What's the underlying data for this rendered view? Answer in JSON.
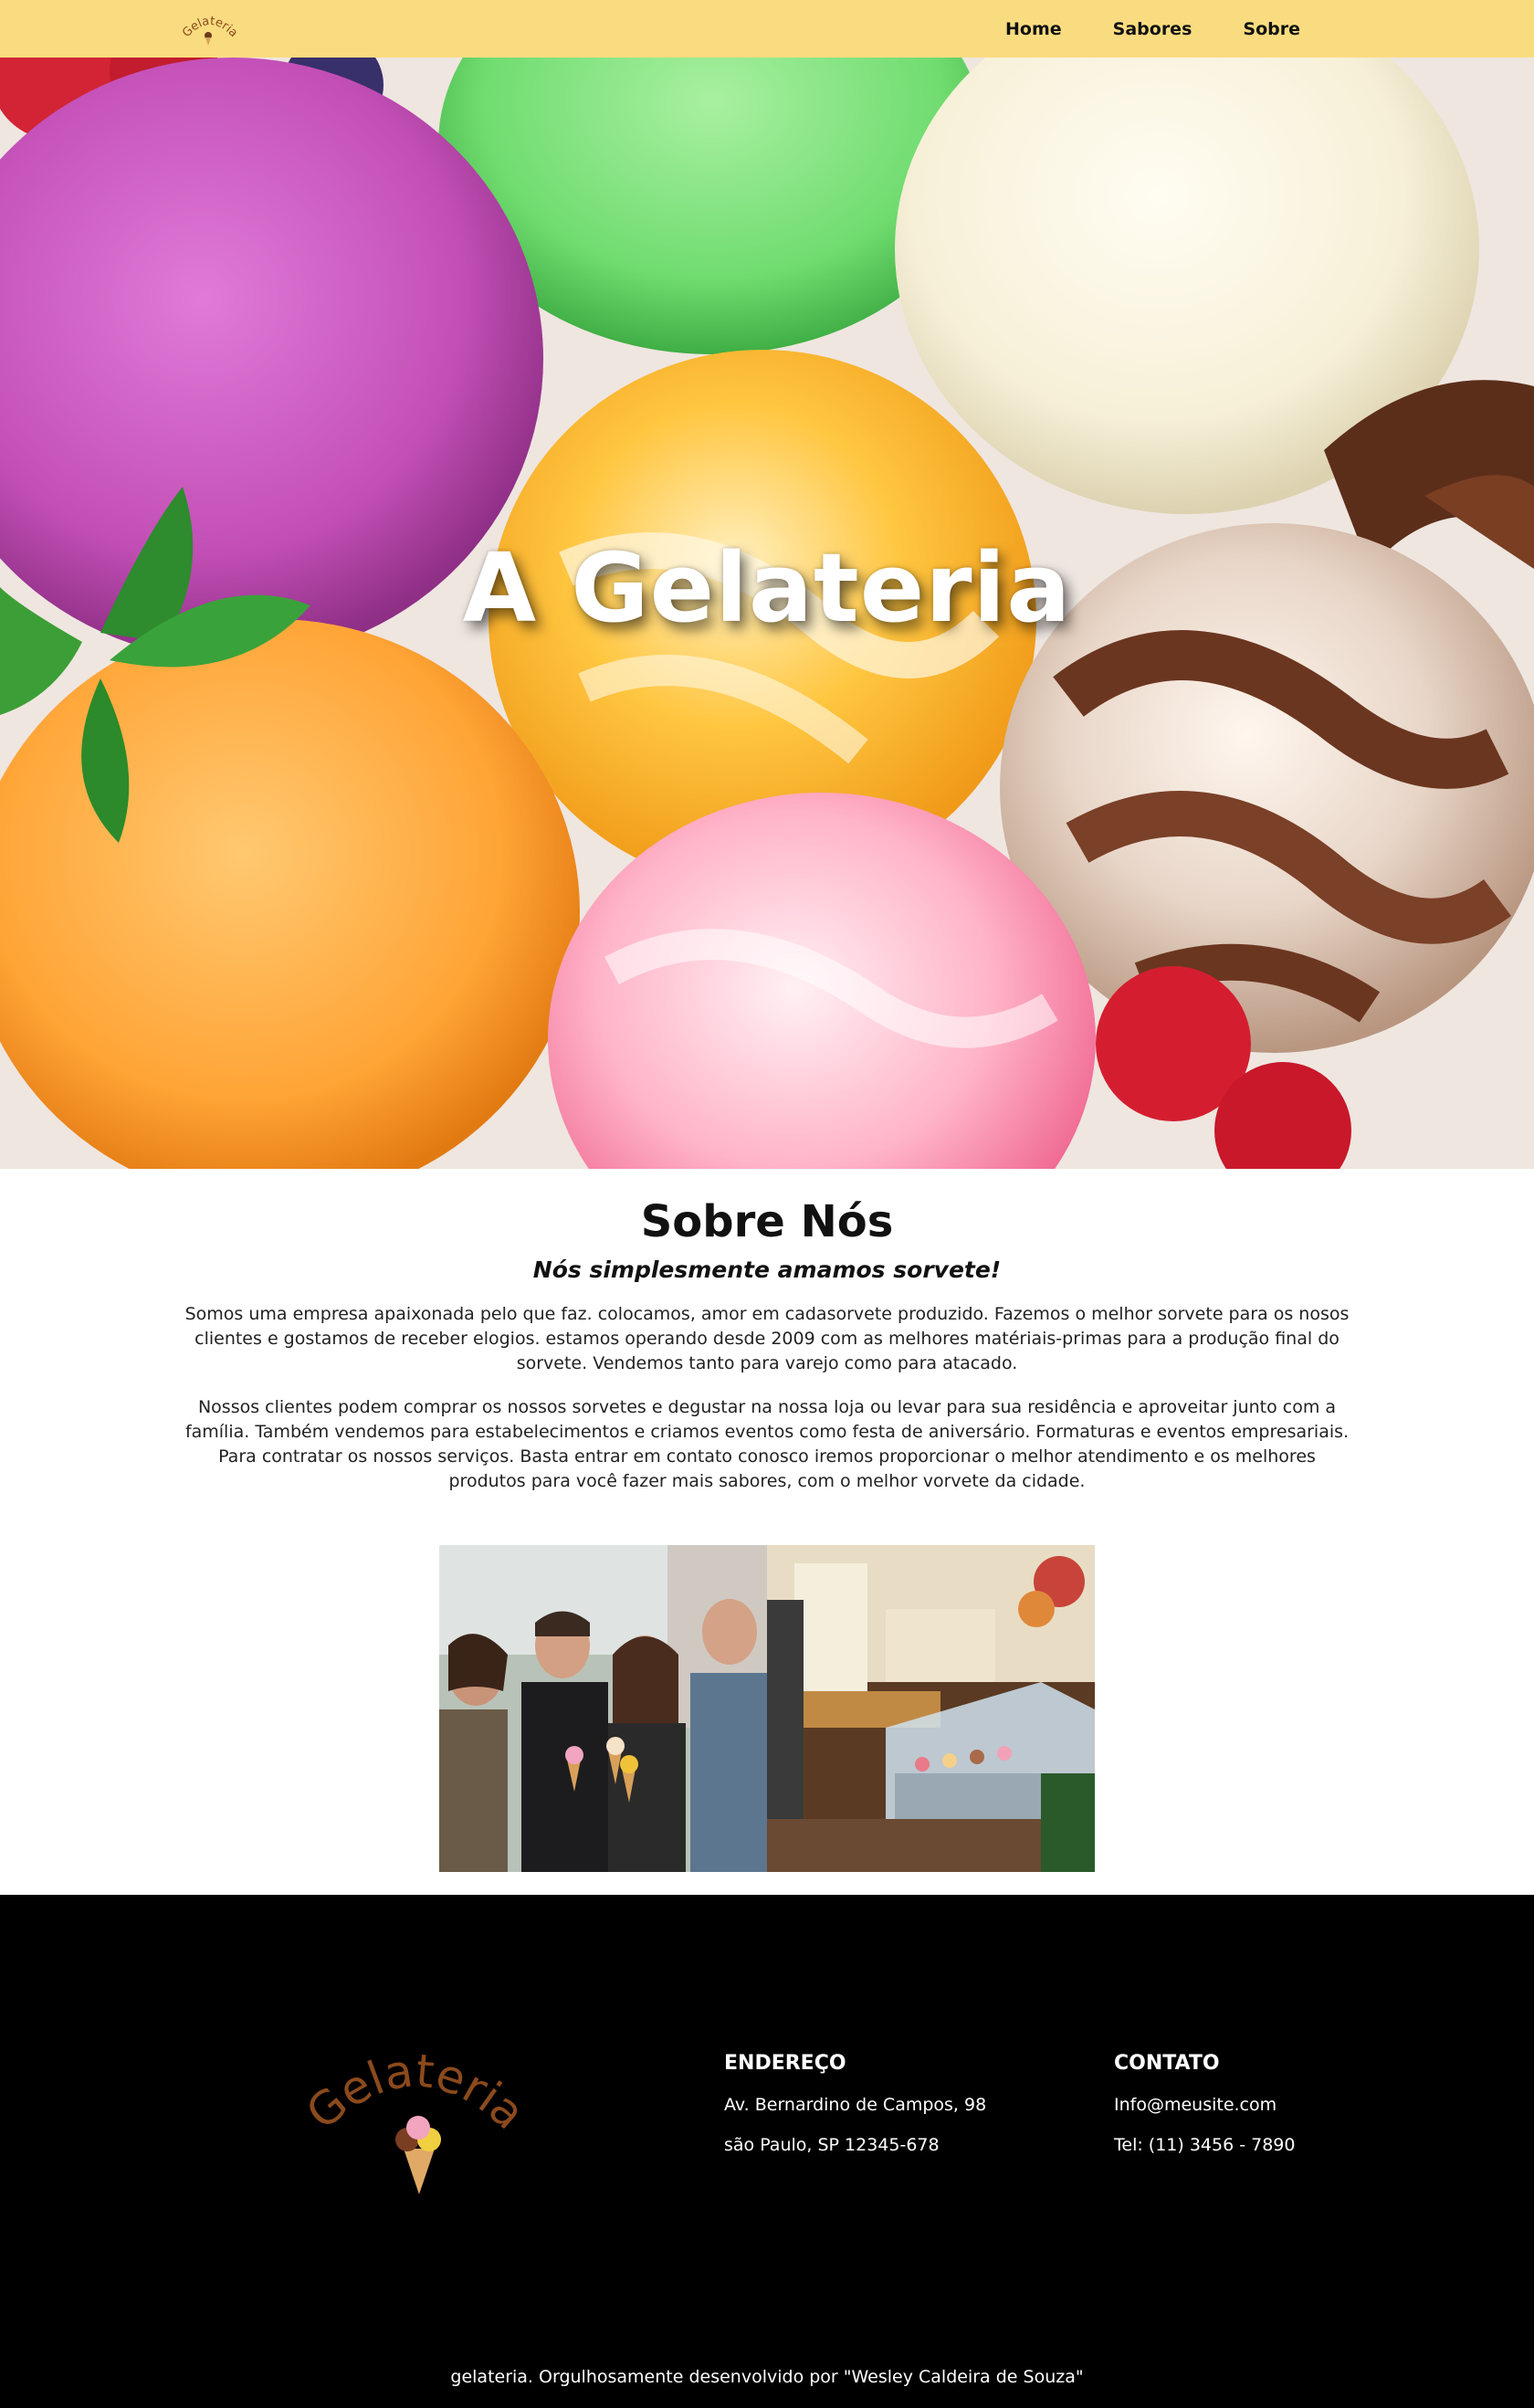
{
  "nav": {
    "logo_text": "Gelateria",
    "links": [
      "Home",
      "Sabores",
      "Sobre"
    ]
  },
  "hero": {
    "title": "A Gelateria"
  },
  "about": {
    "title": "Sobre Nós",
    "subtitle": "Nós simplesmente amamos sorvete!",
    "paragraph_1": "Somos uma empresa apaixonada pelo que faz. colocamos, amor em cadasorvete produzido. Fazemos o melhor sorvete para os nosos clientes e gostamos de receber elogios. estamos operando desde 2009 com as melhores matériais-primas para a produção final do sorvete. Vendemos tanto para varejo como para atacado.",
    "paragraph_2": "Nossos clientes podem comprar os nossos sorvetes e degustar na nossa loja ou levar para sua residência e aproveitar junto com a família. Também vendemos para estabelecimentos e criamos eventos como festa de aniversário. Formaturas e eventos empresariais. Para contratar os nossos serviços. Basta entrar em contato conosco iremos proporcionar o melhor atendimento e os melhores produtos para você fazer mais sabores, com o melhor vorvete da cidade."
  },
  "footer": {
    "logo_text": "Gelateria",
    "address": {
      "title": "ENDEREÇO",
      "line_1": "Av. Bernardino de Campos, 98",
      "line_2": "são Paulo, SP 12345-678"
    },
    "contact": {
      "title": "CONTATO",
      "email": "Info@meusite.com",
      "phone": "Tel: (11) 3456 - 7890"
    },
    "copyright": "gelateria. Orgulhosamente desenvolvido por \"Wesley Caldeira de Souza\""
  },
  "colors": {
    "nav_bg": "#fadc80",
    "footer_bg": "#000000",
    "logo_brown": "#8b4a1c"
  }
}
